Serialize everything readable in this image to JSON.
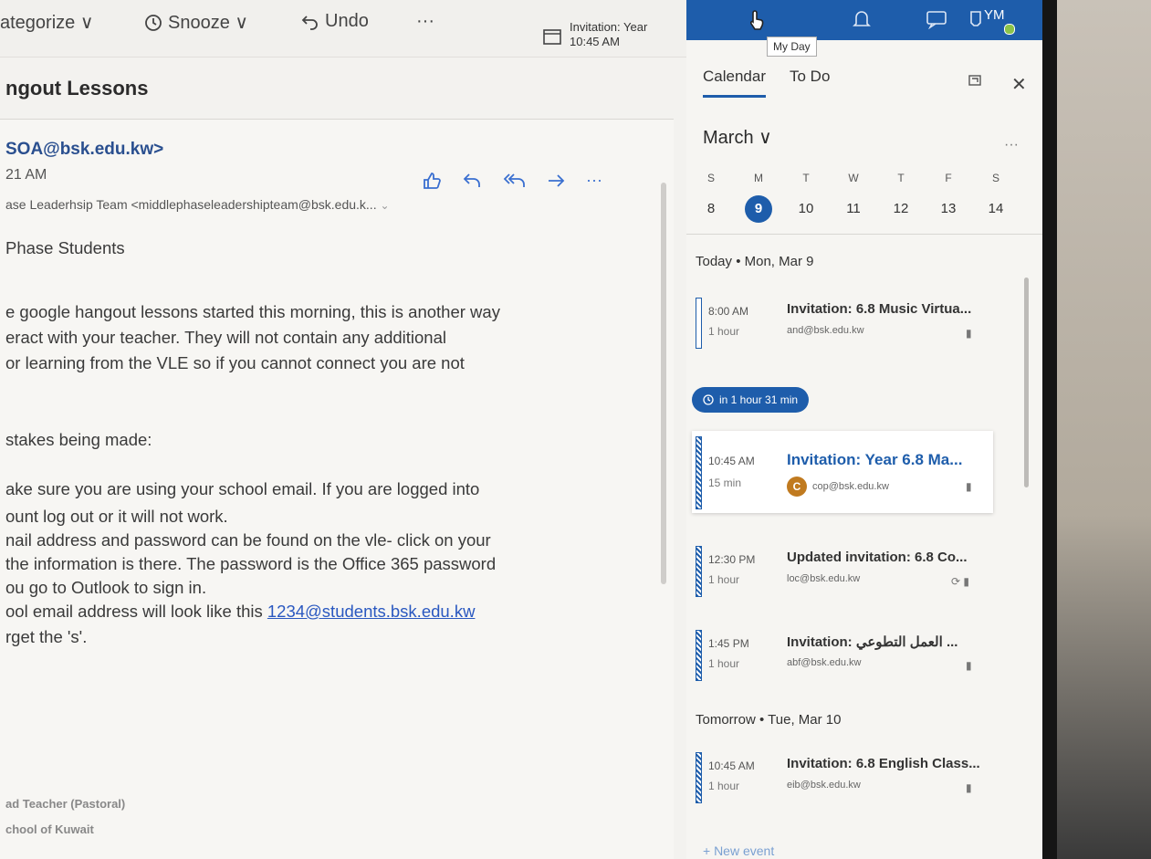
{
  "toolbar": {
    "categorize": "ategorize ∨",
    "snooze": "Snooze ∨",
    "undo": "Undo",
    "more": "···",
    "invite_title": "Invitation: Year",
    "invite_time": "10:45 AM"
  },
  "message": {
    "subject": "ngout Lessons",
    "sender": "SOA@bsk.edu.kw>",
    "time": "21 AM",
    "to": "ase Leaderhsip Team <middlephaseleadershipteam@bsk.edu.k...",
    "more": "···",
    "body": [
      "Phase Students",
      "e google hangout lessons started this morning, this is another way",
      "eract with your teacher. They will not contain any additional",
      "or learning from the VLE so if you cannot connect you are not",
      "stakes being made:",
      "ake sure you are using your school email. If you are logged into",
      "ount log out or it will not work.",
      "nail address and password can be found on the vle- click on your",
      "the information is there. The password is the Office 365 password",
      "ou go to Outlook to sign in.",
      "ool email address will look like this ",
      "rget the 's'."
    ],
    "link": "1234@students.bsk.edu.kw",
    "signature": [
      "ad Teacher (Pastoral)",
      "chool of Kuwait"
    ]
  },
  "topbar": {
    "avatar_initials": "YM",
    "tooltip": "My Day"
  },
  "myday": {
    "tabs": [
      "Calendar",
      "To Do"
    ],
    "close": "✕",
    "month": "March ∨",
    "more": "···",
    "weekdays": [
      "S",
      "M",
      "T",
      "W",
      "T",
      "F",
      "S"
    ],
    "days": [
      "8",
      "9",
      "10",
      "11",
      "12",
      "13",
      "14"
    ],
    "today_header": "Today  •  Mon, Mar 9",
    "countdown": "in 1 hour 31 min",
    "tomorrow_header": "Tomorrow  •  Tue, Mar 10",
    "new_event": "+ New event",
    "events": [
      {
        "time": "8:00 AM",
        "duration": "1 hour",
        "title": "Invitation: 6.8 Music Virtua...",
        "organizer": "and@bsk.edu.kw"
      },
      {
        "time": "10:45 AM",
        "duration": "15 min",
        "title": "Invitation: Year 6.8 Ma...",
        "organizer": "cop@bsk.edu.kw",
        "avatar": "C"
      },
      {
        "time": "12:30 PM",
        "duration": "1 hour",
        "title": "Updated invitation: 6.8 Co...",
        "organizer": "loc@bsk.edu.kw"
      },
      {
        "time": "1:45 PM",
        "duration": "1 hour",
        "title": "Invitation: العمل التطوعي ...",
        "organizer": "abf@bsk.edu.kw"
      },
      {
        "time": "10:45 AM",
        "duration": "1 hour",
        "title": "Invitation: 6.8 English Class...",
        "organizer": "eib@bsk.edu.kw"
      }
    ]
  }
}
